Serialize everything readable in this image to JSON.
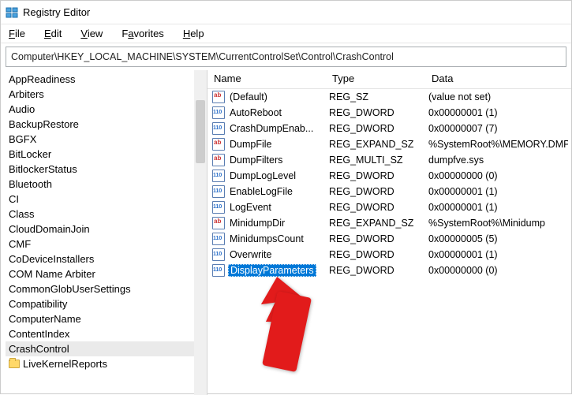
{
  "window": {
    "title": "Registry Editor"
  },
  "menu": {
    "file": "File",
    "edit": "Edit",
    "view": "View",
    "favorites": "Favorites",
    "help": "Help"
  },
  "address": "Computer\\HKEY_LOCAL_MACHINE\\SYSTEM\\CurrentControlSet\\Control\\CrashControl",
  "tree": {
    "items": [
      {
        "label": "AppReadiness",
        "sel": false
      },
      {
        "label": "Arbiters",
        "sel": false
      },
      {
        "label": "Audio",
        "sel": false
      },
      {
        "label": "BackupRestore",
        "sel": false
      },
      {
        "label": "BGFX",
        "sel": false
      },
      {
        "label": "BitLocker",
        "sel": false
      },
      {
        "label": "BitlockerStatus",
        "sel": false
      },
      {
        "label": "Bluetooth",
        "sel": false
      },
      {
        "label": "CI",
        "sel": false
      },
      {
        "label": "Class",
        "sel": false
      },
      {
        "label": "CloudDomainJoin",
        "sel": false
      },
      {
        "label": "CMF",
        "sel": false
      },
      {
        "label": "CoDeviceInstallers",
        "sel": false
      },
      {
        "label": "COM Name Arbiter",
        "sel": false
      },
      {
        "label": "CommonGlobUserSettings",
        "sel": false
      },
      {
        "label": "Compatibility",
        "sel": false
      },
      {
        "label": "ComputerName",
        "sel": false
      },
      {
        "label": "ContentIndex",
        "sel": false
      },
      {
        "label": "CrashControl",
        "sel": true
      },
      {
        "label": "LiveKernelReports",
        "sel": false,
        "folder": true
      }
    ]
  },
  "columns": {
    "name": "Name",
    "type": "Type",
    "data": "Data"
  },
  "values": [
    {
      "icon": "str",
      "name": "(Default)",
      "type": "REG_SZ",
      "data": "(value not set)",
      "sel": false
    },
    {
      "icon": "bin",
      "name": "AutoReboot",
      "type": "REG_DWORD",
      "data": "0x00000001 (1)",
      "sel": false
    },
    {
      "icon": "bin",
      "name": "CrashDumpEnab...",
      "type": "REG_DWORD",
      "data": "0x00000007 (7)",
      "sel": false
    },
    {
      "icon": "str",
      "name": "DumpFile",
      "type": "REG_EXPAND_SZ",
      "data": "%SystemRoot%\\MEMORY.DMP",
      "sel": false
    },
    {
      "icon": "str",
      "name": "DumpFilters",
      "type": "REG_MULTI_SZ",
      "data": "dumpfve.sys",
      "sel": false
    },
    {
      "icon": "bin",
      "name": "DumpLogLevel",
      "type": "REG_DWORD",
      "data": "0x00000000 (0)",
      "sel": false
    },
    {
      "icon": "bin",
      "name": "EnableLogFile",
      "type": "REG_DWORD",
      "data": "0x00000001 (1)",
      "sel": false
    },
    {
      "icon": "bin",
      "name": "LogEvent",
      "type": "REG_DWORD",
      "data": "0x00000001 (1)",
      "sel": false
    },
    {
      "icon": "str",
      "name": "MinidumpDir",
      "type": "REG_EXPAND_SZ",
      "data": "%SystemRoot%\\Minidump",
      "sel": false
    },
    {
      "icon": "bin",
      "name": "MinidumpsCount",
      "type": "REG_DWORD",
      "data": "0x00000005 (5)",
      "sel": false
    },
    {
      "icon": "bin",
      "name": "Overwrite",
      "type": "REG_DWORD",
      "data": "0x00000001 (1)",
      "sel": false
    },
    {
      "icon": "bin",
      "name": "DisplayParameters",
      "type": "REG_DWORD",
      "data": "0x00000000 (0)",
      "sel": true
    }
  ]
}
